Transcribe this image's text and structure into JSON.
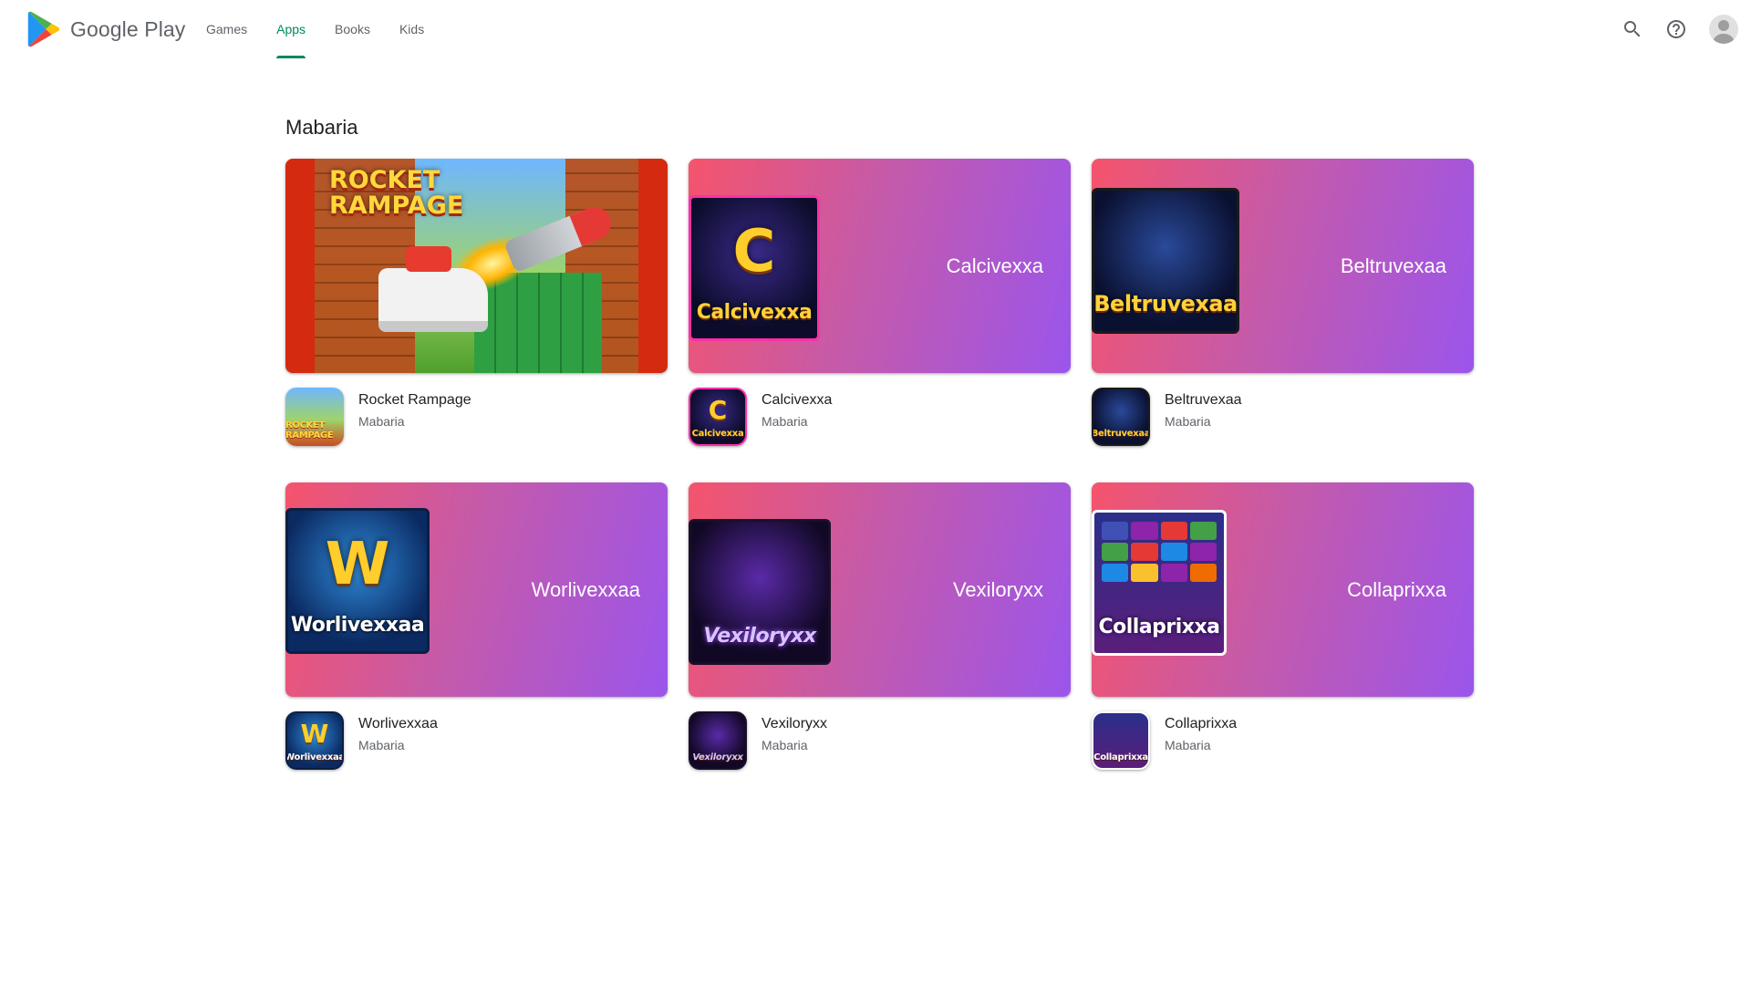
{
  "header": {
    "logo_text": "Google Play",
    "nav": [
      {
        "label": "Games",
        "active": false
      },
      {
        "label": "Apps",
        "active": true
      },
      {
        "label": "Books",
        "active": false
      },
      {
        "label": "Kids",
        "active": false
      }
    ],
    "icons": [
      "search-icon",
      "help-icon",
      "account-avatar"
    ]
  },
  "colors": {
    "accent": "#01875f",
    "banner_gradient_start": "#f5546c",
    "banner_gradient_end": "#9b55ec"
  },
  "section": {
    "title": "Mabaria"
  },
  "apps": [
    {
      "name": "Rocket Rampage",
      "developer": "Mabaria",
      "banner_title": "ROCKET RAMPAGE",
      "banner_label": ""
    },
    {
      "name": "Calcivexxa",
      "developer": "Mabaria",
      "banner_label": "Calcivexxa",
      "art_word": "Calcivexxa",
      "art_big": "C",
      "icon_word": "Calcivexxa",
      "icon_big": "C"
    },
    {
      "name": "Beltruvexaa",
      "developer": "Mabaria",
      "banner_label": "Beltruvexaa",
      "art_word": "Beltruvexaa",
      "icon_word": "Beltruvexaa"
    },
    {
      "name": "Worlivexxaa",
      "developer": "Mabaria",
      "banner_label": "Worlivexxaa",
      "art_word": "Worlivexxaa",
      "art_big": "W",
      "icon_word": "Worlivexxaa",
      "icon_big": "W"
    },
    {
      "name": "Vexiloryxx",
      "developer": "Mabaria",
      "banner_label": "Vexiloryxx",
      "art_word": "Vexiloryxx",
      "icon_word": "Vexiloryxx"
    },
    {
      "name": "Collaprixxa",
      "developer": "Mabaria",
      "banner_label": "Collaprixxa",
      "art_word": "Collaprixxa",
      "icon_word": "Collaprixxa"
    }
  ]
}
